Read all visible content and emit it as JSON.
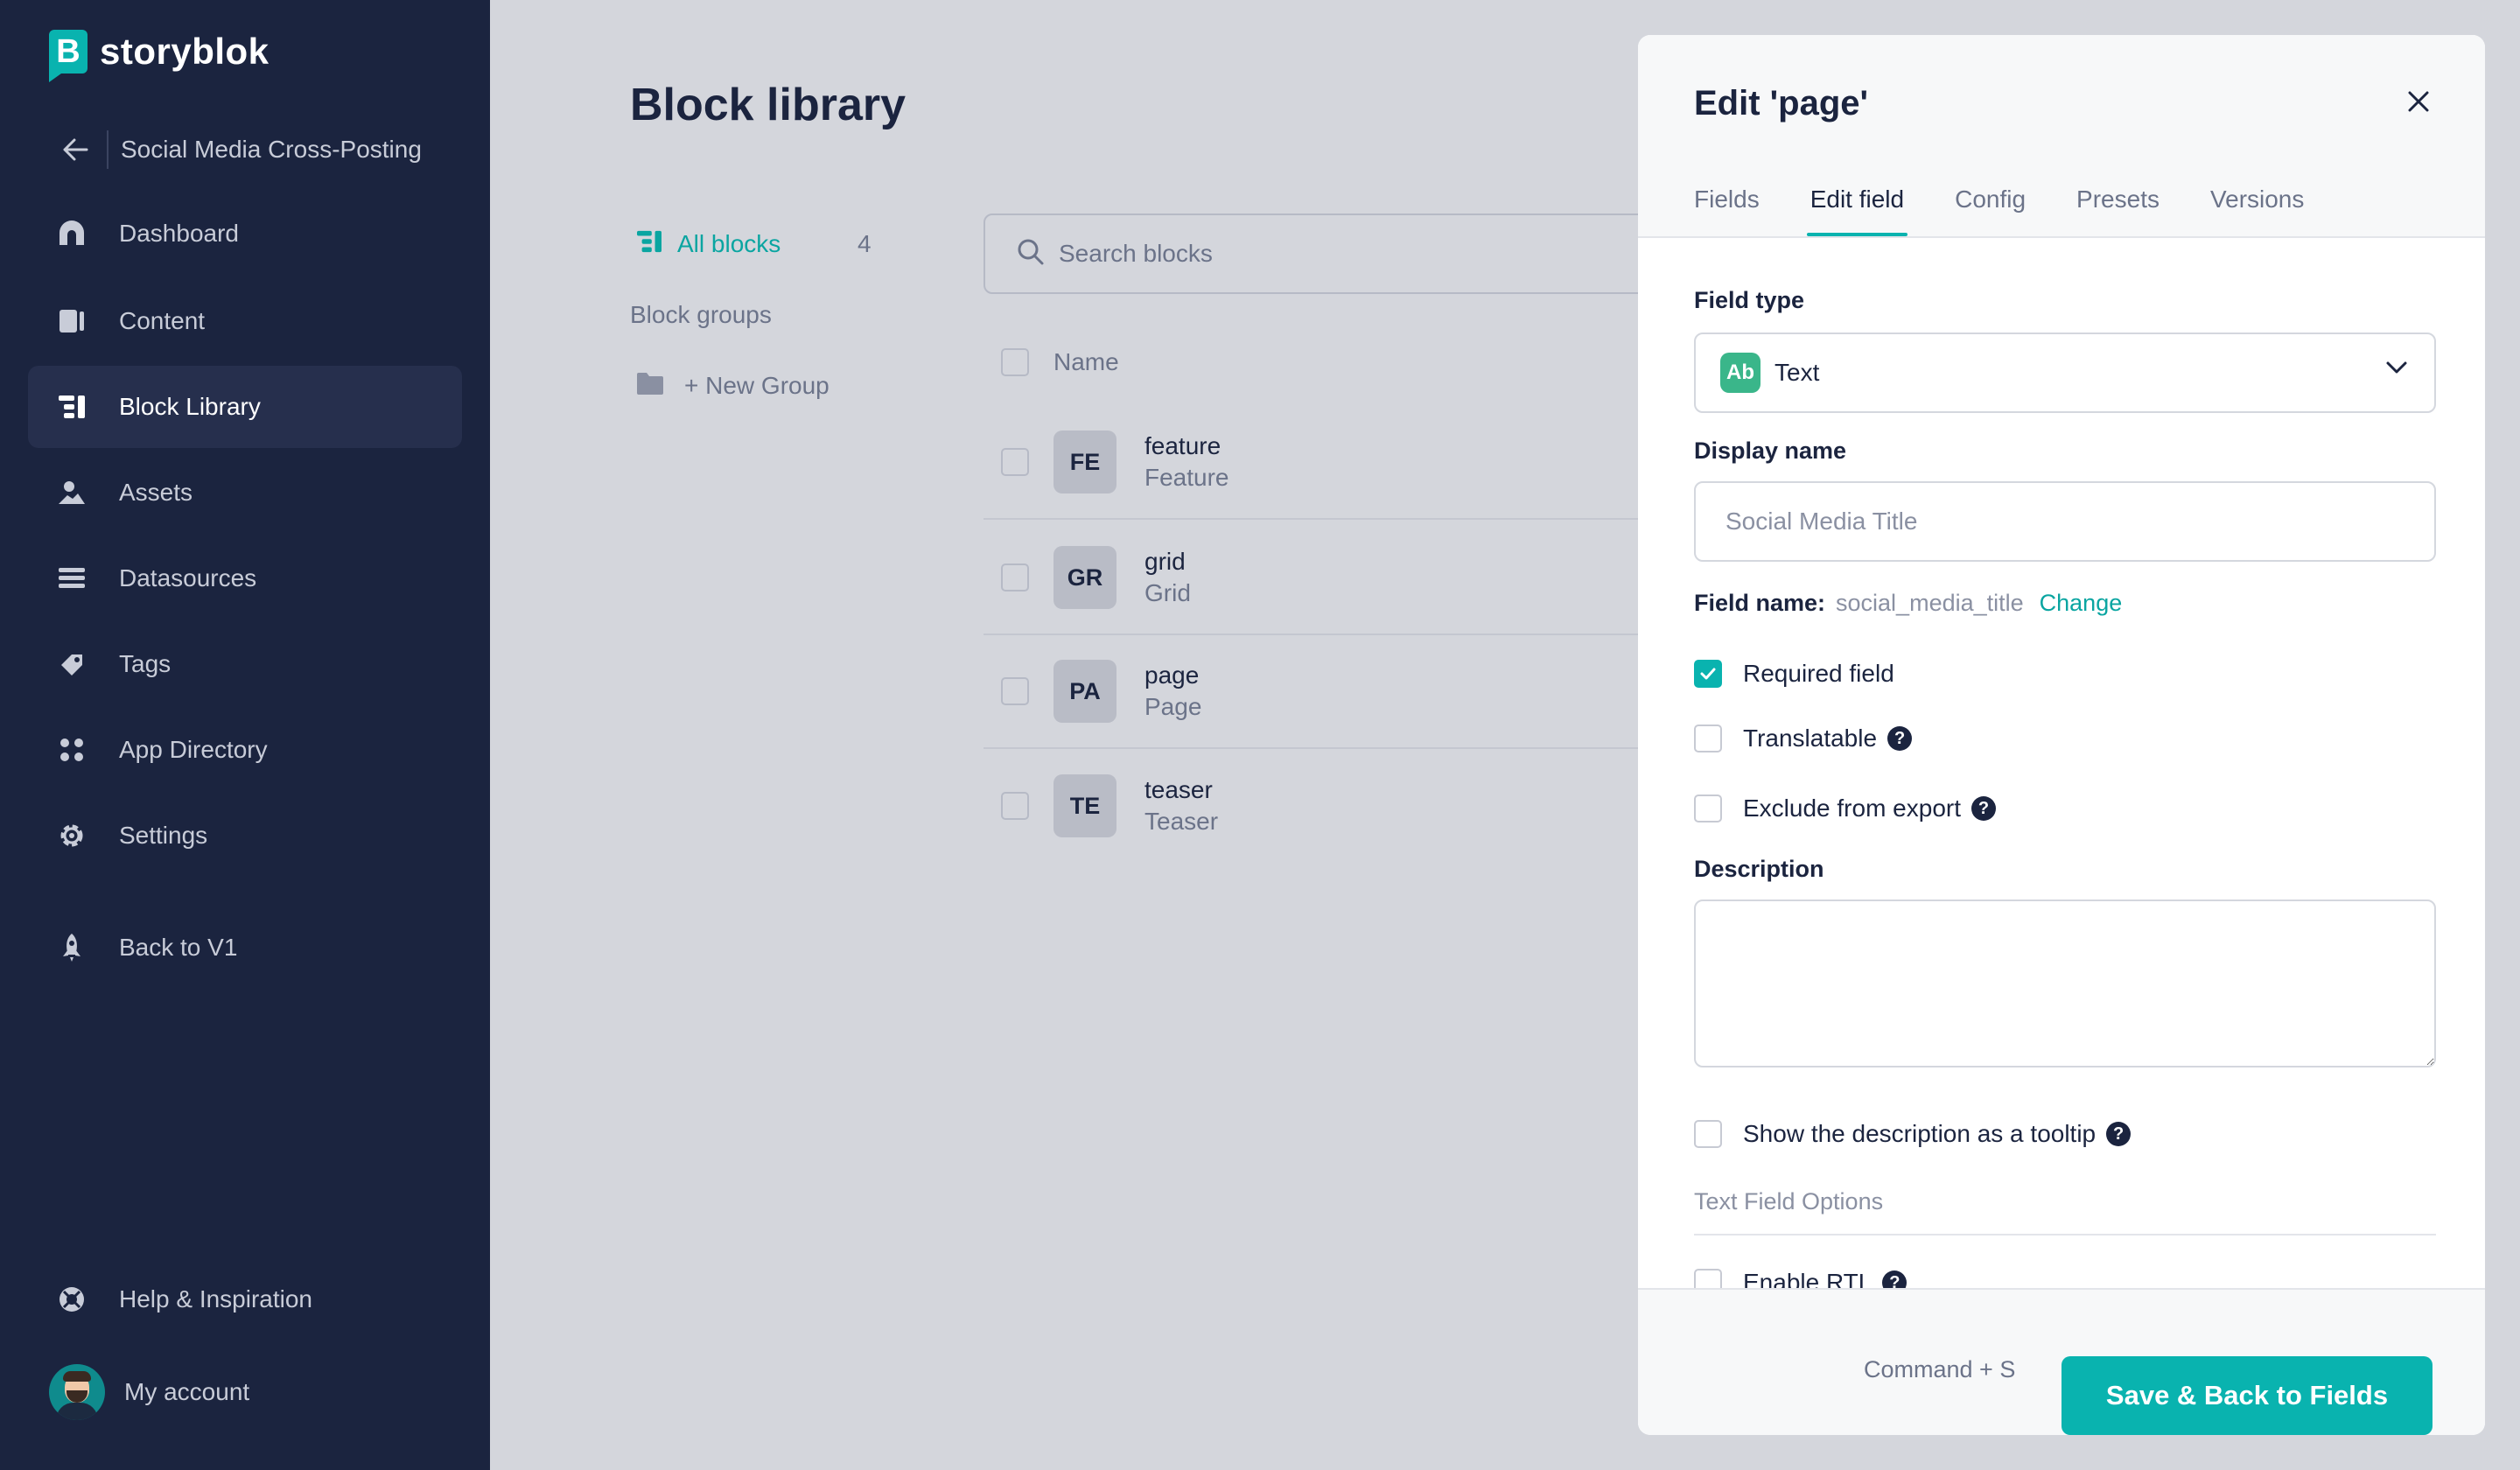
{
  "brand": {
    "name": "storyblok",
    "mark": "B",
    "accent": "#09b3af"
  },
  "space": {
    "name": "Social Media Cross-Posting"
  },
  "sidebar": {
    "items": [
      {
        "label": "Dashboard",
        "icon": "dashboard-icon"
      },
      {
        "label": "Content",
        "icon": "content-icon"
      },
      {
        "label": "Block Library",
        "icon": "block-library-icon",
        "active": true
      },
      {
        "label": "Assets",
        "icon": "assets-icon"
      },
      {
        "label": "Datasources",
        "icon": "datasources-icon"
      },
      {
        "label": "Tags",
        "icon": "tags-icon"
      },
      {
        "label": "App Directory",
        "icon": "app-directory-icon"
      },
      {
        "label": "Settings",
        "icon": "settings-icon"
      },
      {
        "label": "Back to V1",
        "icon": "rocket-icon"
      }
    ],
    "help": "Help & Inspiration",
    "account": "My account"
  },
  "main": {
    "title": "Block library",
    "all_blocks": {
      "label": "All blocks",
      "count": "4"
    },
    "block_groups": "Block groups",
    "new_group": "+ New Group",
    "search_placeholder": "Search blocks",
    "column_name": "Name",
    "rows": [
      {
        "badge": "FE",
        "name": "feature",
        "display": "Feature"
      },
      {
        "badge": "GR",
        "name": "grid",
        "display": "Grid"
      },
      {
        "badge": "PA",
        "name": "page",
        "display": "Page"
      },
      {
        "badge": "TE",
        "name": "teaser",
        "display": "Teaser"
      }
    ]
  },
  "modal": {
    "title": "Edit 'page'",
    "tabs": [
      "Fields",
      "Edit field",
      "Config",
      "Presets",
      "Versions"
    ],
    "active_tab": "Edit field",
    "field_type_label": "Field type",
    "field_type_icon": "Ab",
    "field_type_value": "Text",
    "display_name_label": "Display name",
    "display_name_placeholder": "Social Media Title",
    "field_name_label": "Field name:",
    "field_name_value": "social_media_title",
    "change_link": "Change",
    "required_label": "Required field",
    "required_checked": true,
    "translatable_label": "Translatable",
    "exclude_label": "Exclude from export",
    "description_label": "Description",
    "tooltip_label": "Show the description as a tooltip",
    "section_label": "Text Field Options",
    "rtl_label": "Enable RTL",
    "shortcut": "Command + S",
    "save_label": "Save & Back to Fields"
  }
}
